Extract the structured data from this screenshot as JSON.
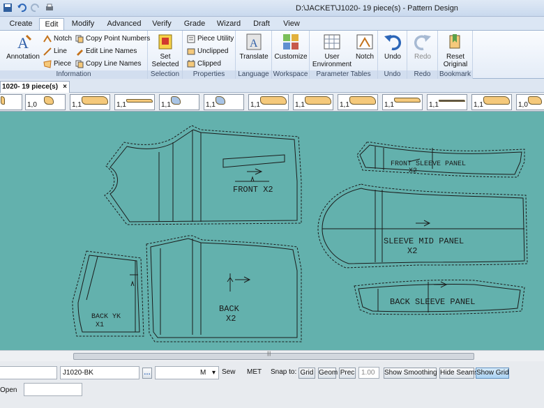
{
  "window": {
    "title": "D:\\JACKET\\J1020-   19 piece(s) - Pattern Design"
  },
  "tabs": [
    {
      "label": "Create"
    },
    {
      "label": "Edit"
    },
    {
      "label": "Modify"
    },
    {
      "label": "Advanced"
    },
    {
      "label": "Verify"
    },
    {
      "label": "Grade"
    },
    {
      "label": "Wizard"
    },
    {
      "label": "Draft"
    },
    {
      "label": "View"
    }
  ],
  "ribbon": {
    "information": {
      "label": "Information",
      "annotation": "Annotation",
      "notch": "Notch",
      "line": "Line",
      "piece": "Piece",
      "copy_point_numbers": "Copy Point Numbers",
      "edit_line_names": "Edit Line Names",
      "copy_line_names": "Copy Line Names"
    },
    "selection": {
      "label": "Selection",
      "set_selected": "Set Selected"
    },
    "properties": {
      "label": "Properties",
      "piece_utility": "Piece Utility",
      "unclipped": "Unclipped",
      "clipped": "Clipped"
    },
    "language": {
      "label": "Language",
      "translate": "Translate"
    },
    "workspace": {
      "label": "Workspace",
      "customize": "Customize"
    },
    "parameter_tables": {
      "label": "Parameter Tables",
      "user_environment": "User Environment",
      "notch": "Notch"
    },
    "undo_group": {
      "label": "Undo",
      "undo": "Undo"
    },
    "redo_group": {
      "label": "Redo",
      "redo": "Redo"
    },
    "bookmark": {
      "label": "Bookmark",
      "reset_original": "Reset Original"
    }
  },
  "document_tab": {
    "label": "1020-   19 piece(s)",
    "close": "×"
  },
  "piece_strip": {
    "labels": [
      "1,0",
      "1,1",
      "1,1",
      "1,1",
      "1,1",
      "1,1",
      "1,1",
      "1,1",
      "1,1",
      "1,1",
      "1,1",
      "1,0"
    ]
  },
  "pieces": {
    "front": "FRONT X2",
    "back_line1": "BACK",
    "back_line2": "X2",
    "back_yk_line1": "BACK YK",
    "back_yk_line2": "X1",
    "front_sleeve_line1": "FRONT SLEEVE PANEL",
    "front_sleeve_line2": "X2",
    "sleeve_mid_line1": "SLEEVE MID PANEL",
    "sleeve_mid_line2": "X2",
    "back_sleeve": "BACK SLEEVE PANEL"
  },
  "status_bar": {
    "piece_name": "J1020-BK",
    "size": "M",
    "sew_label": "Sew",
    "units": "MET",
    "snap_label": "Snap to:",
    "grid": "Grid",
    "geom": "Geom",
    "prec": "Prec",
    "precision": "1.00",
    "show_smoothing": "Show Smoothing",
    "hide_seams": "Hide Seams",
    "show_grid": "Show Grid",
    "open_label": "Open"
  },
  "colors": {
    "canvas": "#63b1ad",
    "piece_fill": "#f5c97b",
    "ribbon_active": "#ffffff"
  }
}
